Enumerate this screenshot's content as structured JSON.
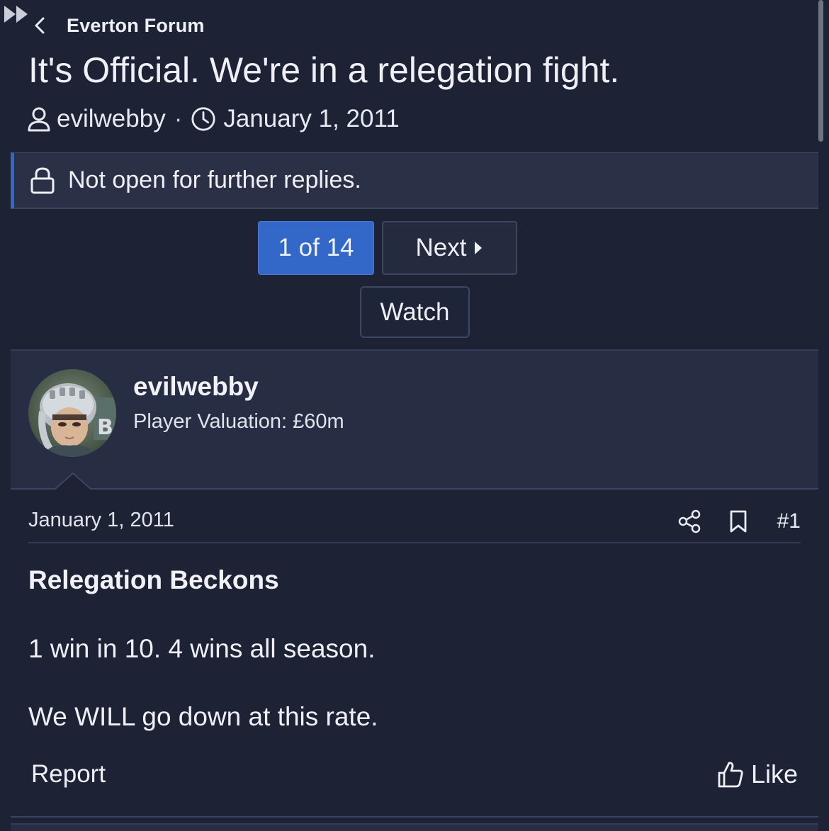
{
  "breadcrumb": {
    "label": "Everton Forum"
  },
  "thread": {
    "title": "It's Official. We're in a relegation fight.",
    "author": "evilwebby",
    "separator": "·",
    "date": "January 1, 2011"
  },
  "notice": {
    "text": "Not open for further replies."
  },
  "pagination": {
    "current": "1 of 14",
    "next_label": "Next"
  },
  "watch": {
    "label": "Watch"
  },
  "post": {
    "user": {
      "name": "evilwebby",
      "title": "Player Valuation: £60m"
    },
    "date": "January 1, 2011",
    "number": "#1",
    "heading": "Relegation Beckons",
    "lines": [
      "1 win in 10. 4 wins all season.",
      "We WILL go down at this rate."
    ],
    "report_label": "Report",
    "like_label": "Like"
  },
  "colors": {
    "background": "#1d2335",
    "panel": "#272d42",
    "accent": "#3468c8",
    "border": "#3b4460"
  },
  "icons": [
    "chevron-left-icon",
    "user-icon",
    "clock-icon",
    "lock-icon",
    "next-triangle-icon",
    "fast-forward-icon",
    "share-icon",
    "bookmark-icon",
    "thumbs-up-icon"
  ]
}
